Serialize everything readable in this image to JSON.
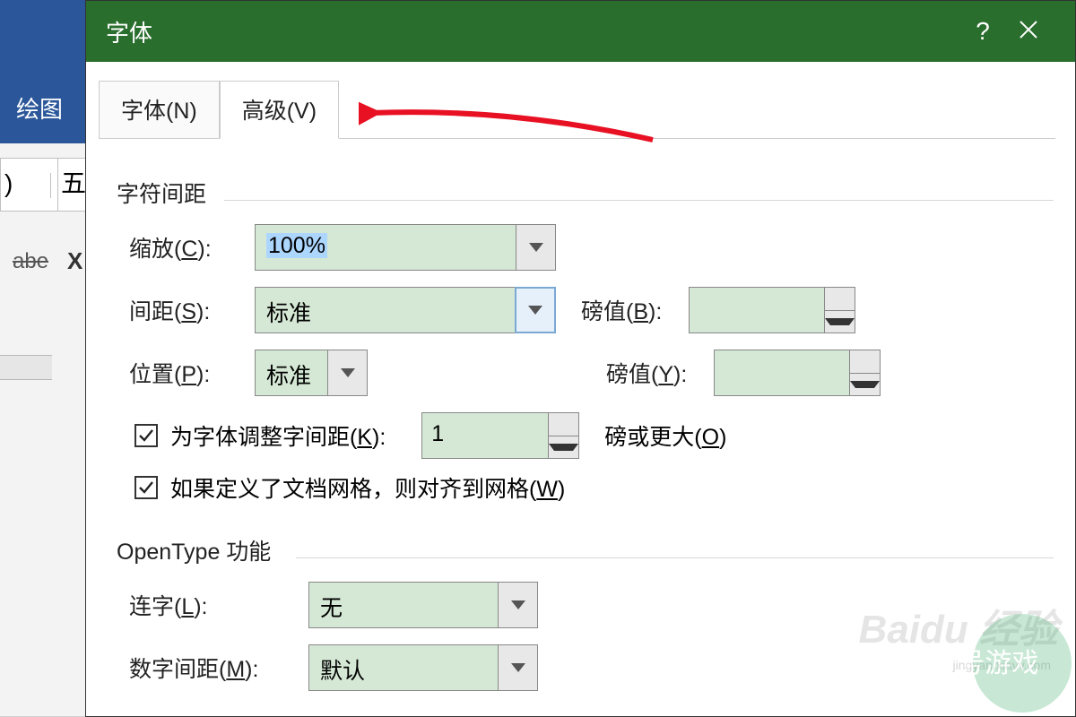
{
  "background": {
    "ribbon_tab": "绘图",
    "toolbar_char": ")",
    "toolbar_char2": "五",
    "strike_text": "abe",
    "x_text": "X"
  },
  "dialog": {
    "title": "字体",
    "help": "?",
    "tabs": {
      "font": "字体(N)",
      "advanced": "高级(V)"
    },
    "char_spacing": {
      "section": "字符间距",
      "scale_label": "缩放(C):",
      "scale_value": "100%",
      "spacing_label": "间距(S):",
      "spacing_value": "标准",
      "spacing_pt_label": "磅值(B):",
      "spacing_pt_value": "",
      "position_label": "位置(P):",
      "position_value": "标准",
      "position_pt_label": "磅值(Y):",
      "position_pt_value": "",
      "kerning_label": "为字体调整字间距(K):",
      "kerning_value": "1",
      "kerning_suffix": "磅或更大(O)",
      "snap_label": "如果定义了文档网格，则对齐到网格(W)"
    },
    "opentype": {
      "section": "OpenType 功能",
      "ligatures_label": "连字(L):",
      "ligatures_value": "无",
      "num_spacing_label": "数字间距(M):",
      "num_spacing_value": "默认"
    }
  },
  "watermark": {
    "text1": "Baidu 经验",
    "text2": "jingyan.xiavv.com",
    "text3": "7号游戏"
  }
}
